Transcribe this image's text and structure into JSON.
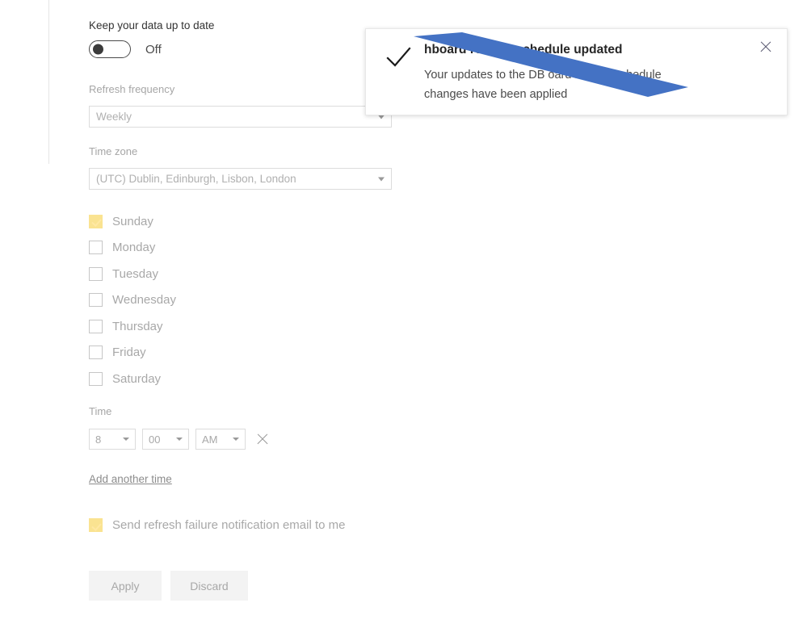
{
  "settings": {
    "section_title": "Keep your data up to date",
    "toggle": {
      "state_label": "Off",
      "checked": false
    },
    "refresh_frequency": {
      "label": "Refresh frequency",
      "value": "Weekly"
    },
    "time_zone": {
      "label": "Time zone",
      "value": "(UTC) Dublin, Edinburgh, Lisbon, London"
    },
    "days": [
      {
        "label": "Sunday",
        "checked": true
      },
      {
        "label": "Monday",
        "checked": false
      },
      {
        "label": "Tuesday",
        "checked": false
      },
      {
        "label": "Wednesday",
        "checked": false
      },
      {
        "label": "Thursday",
        "checked": false
      },
      {
        "label": "Friday",
        "checked": false
      },
      {
        "label": "Saturday",
        "checked": false
      }
    ],
    "time": {
      "label": "Time",
      "hour": "8",
      "minute": "00",
      "ampm": "AM",
      "remove_icon": "close-x-icon"
    },
    "add_another_time": "Add another time",
    "notify": {
      "label": "Send refresh failure notification email to me",
      "checked": true
    },
    "buttons": {
      "apply": "Apply",
      "discard": "Discard"
    }
  },
  "toast": {
    "icon": "checkmark-icon",
    "close_icon": "close-x-icon",
    "title": "hboard refresh schedule updated",
    "body_line_1": "Your updates to the DB              oard refresh schedule",
    "body_line_2": "changes have been applied",
    "redaction_color": "#4472C4"
  },
  "colors": {
    "checkbox_checked": "#fae391",
    "button_background": "#f3f3f3",
    "muted_text": "#a8a8a8",
    "redaction_blue": "#4472C4"
  }
}
